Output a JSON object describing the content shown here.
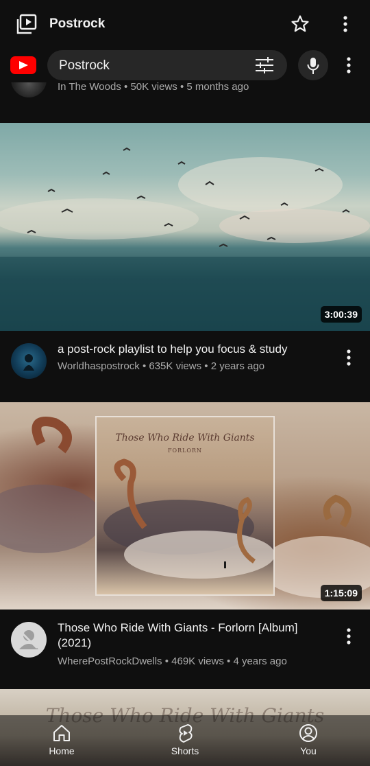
{
  "header": {
    "title": "Postrock"
  },
  "search": {
    "query": "Postrock"
  },
  "videos": [
    {
      "channel": "In The Woods",
      "views": "50K views",
      "age": "5 months ago"
    },
    {
      "title": "a post-rock playlist to help you focus & study",
      "channel": "Worldhaspostrock",
      "views": "635K views",
      "age": "2 years ago",
      "duration": "3:00:39"
    },
    {
      "title": "Those Who Ride With Giants - Forlorn [Album] (2021)",
      "channel": "WherePostRockDwells",
      "views": "469K views",
      "age": "4 years ago",
      "duration": "1:15:09",
      "artwork_title": "Those Who Ride With Giants",
      "artwork_subtitle": "FORLORN"
    },
    {
      "artwork_title": "Those Who Ride With Giants"
    }
  ],
  "nav": {
    "home": "Home",
    "shorts": "Shorts",
    "you": "You"
  },
  "colors": {
    "background": "#0f0f0f",
    "surface": "#272727",
    "text_primary": "#f1f1f1",
    "text_secondary": "#aaaaaa",
    "brand": "#ff0000"
  },
  "icons": [
    "playlist-icon",
    "star-icon",
    "more-vert-icon",
    "youtube-logo",
    "filter-icon",
    "mic-icon",
    "home-icon",
    "shorts-icon",
    "account-icon"
  ]
}
